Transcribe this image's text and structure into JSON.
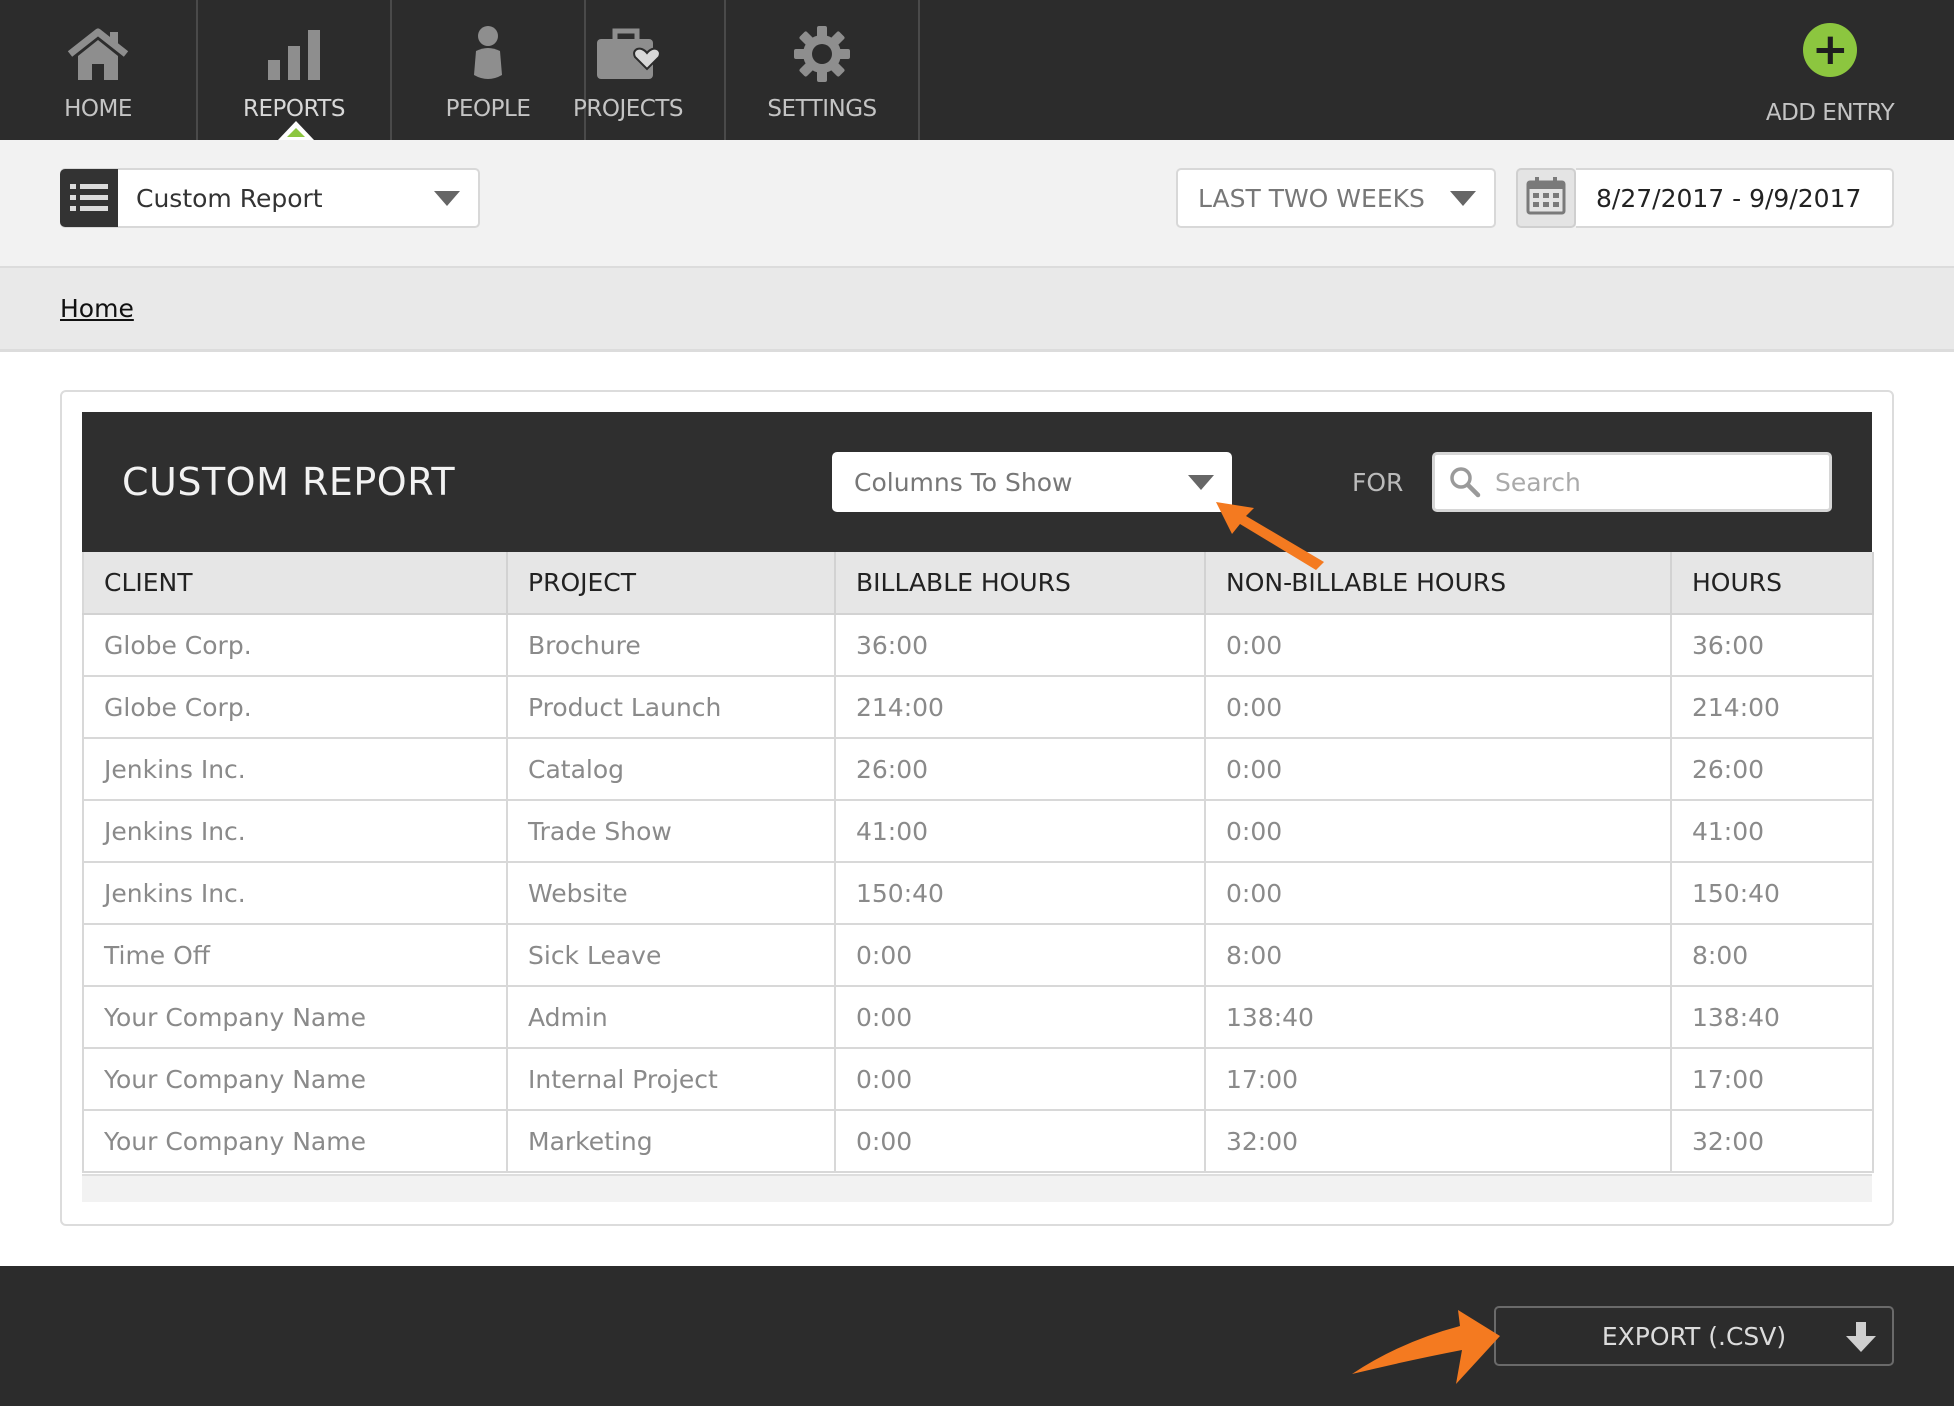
{
  "nav": {
    "items": [
      {
        "label": "HOME",
        "icon": "home-icon"
      },
      {
        "label": "REPORTS",
        "icon": "bar-chart-icon"
      },
      {
        "label": "PEOPLE",
        "icon": "person-icon"
      },
      {
        "label": "PROJECTS",
        "icon": "briefcase-heart-icon"
      },
      {
        "label": "SETTINGS",
        "icon": "gear-icon"
      }
    ],
    "active": "REPORTS",
    "add_entry": {
      "label": "ADD ENTRY",
      "icon": "plus-circle-icon"
    }
  },
  "toolbar": {
    "report_select": "Custom Report",
    "range_select": "LAST TWO WEEKS",
    "date_range": "8/27/2017 - 9/9/2017"
  },
  "breadcrumb": {
    "home": "Home"
  },
  "report": {
    "title": "CUSTOM REPORT",
    "columns_select": "Columns To Show",
    "for_label": "FOR",
    "search_placeholder": "Search",
    "headers": [
      "CLIENT",
      "PROJECT",
      "BILLABLE HOURS",
      "NON-BILLABLE HOURS",
      "HOURS"
    ],
    "rows": [
      [
        "Globe Corp.",
        "Brochure",
        "36:00",
        "0:00",
        "36:00"
      ],
      [
        "Globe Corp.",
        "Product Launch",
        "214:00",
        "0:00",
        "214:00"
      ],
      [
        "Jenkins Inc.",
        "Catalog",
        "26:00",
        "0:00",
        "26:00"
      ],
      [
        "Jenkins Inc.",
        "Trade Show",
        "41:00",
        "0:00",
        "41:00"
      ],
      [
        "Jenkins Inc.",
        "Website",
        "150:40",
        "0:00",
        "150:40"
      ],
      [
        "Time Off",
        "Sick Leave",
        "0:00",
        "8:00",
        "8:00"
      ],
      [
        "Your Company Name",
        "Admin",
        "0:00",
        "138:40",
        "138:40"
      ],
      [
        "Your Company Name",
        "Internal Project",
        "0:00",
        "17:00",
        "17:00"
      ],
      [
        "Your Company Name",
        "Marketing",
        "0:00",
        "32:00",
        "32:00"
      ]
    ]
  },
  "footer": {
    "export_label": "EXPORT (.CSV)"
  },
  "colors": {
    "accent": "#8cc63f",
    "annotation": "#f47a20",
    "nav_bg": "#2c2c2c"
  }
}
